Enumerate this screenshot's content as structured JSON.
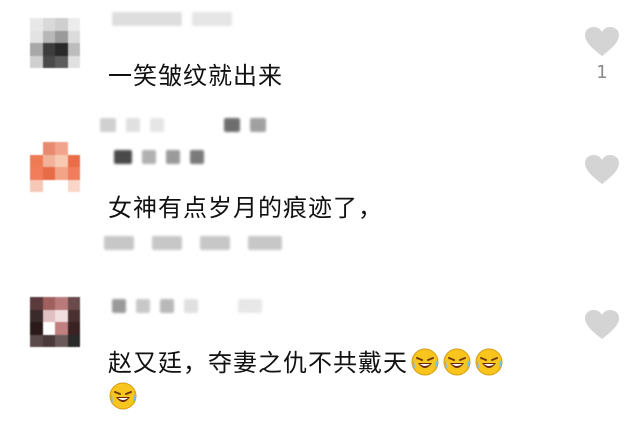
{
  "comments": [
    {
      "text": "一笑皱纹就出来",
      "likes": "1"
    },
    {
      "text": "女神有点岁月的痕迹了，"
    },
    {
      "text": "赵又廷，夺妻之仇不共戴天",
      "emoji": "laughing-crying-emoji"
    }
  ],
  "icons": {
    "like": "heart-icon",
    "heart_color": "#d4d4d4"
  }
}
